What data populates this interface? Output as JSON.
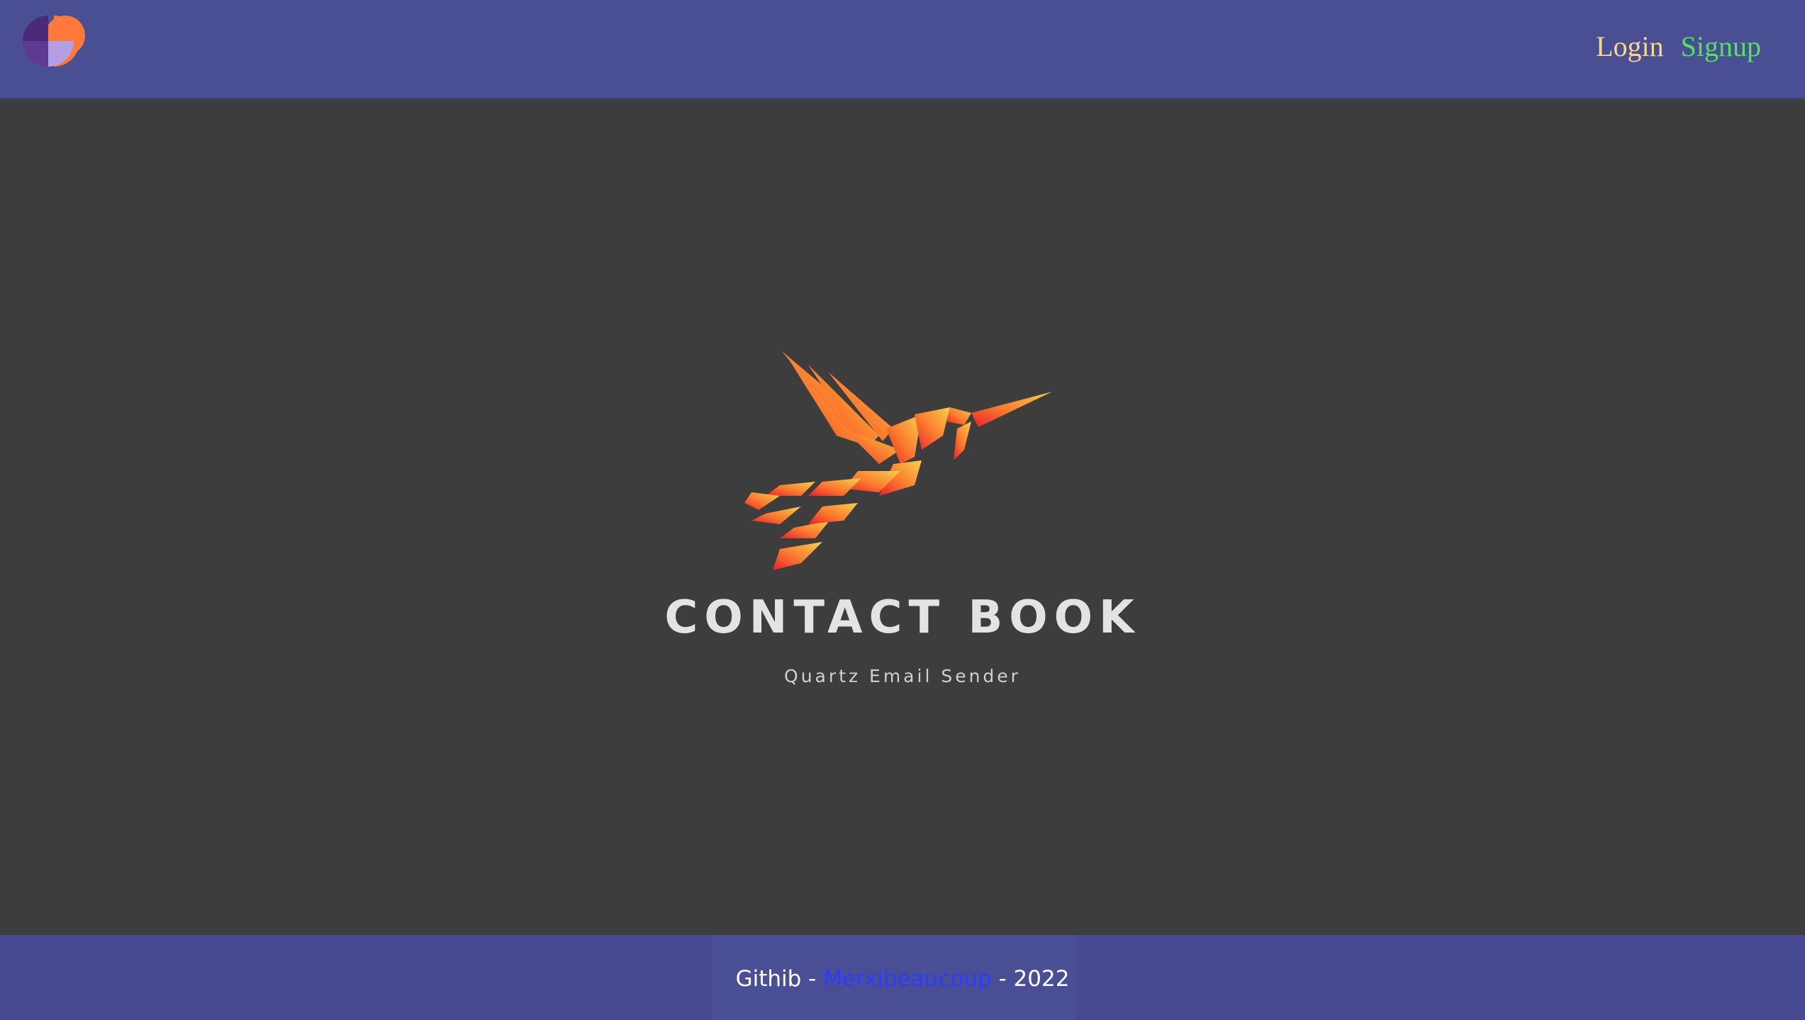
{
  "header": {
    "logo_icon": "app-logo-icon",
    "login_label": "Login",
    "signup_label": "Signup",
    "colors": {
      "background": "#4a4f93",
      "login": "#f6d98c",
      "signup": "#4fe35e"
    }
  },
  "hero": {
    "logo_icon": "hummingbird-icon",
    "title": "CONTACT BOOK",
    "subtitle": "Quartz Email Sender"
  },
  "footer": {
    "prefix": "Githib - ",
    "link_label": "Merxibeaucoup",
    "suffix": " - 2022",
    "colors": {
      "background": "#474a91",
      "link": "#2b3cff"
    }
  }
}
